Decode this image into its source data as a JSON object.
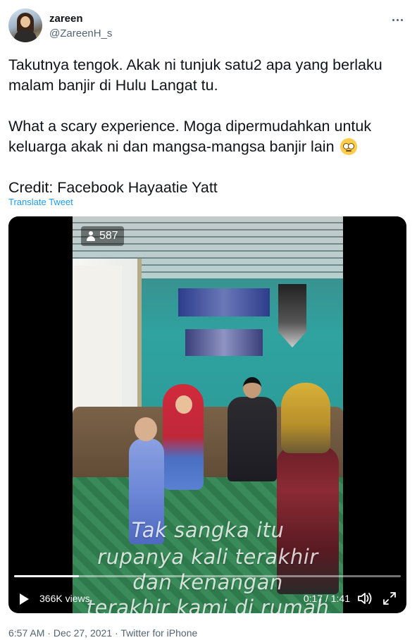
{
  "author": {
    "name": "zareen",
    "handle": "@ZareenH_s"
  },
  "tweet": {
    "line1": "Takutnya tengok. Akak ni tunjuk satu2 apa yang berlaku",
    "line2": "malam banjir di Hulu Langat tu.",
    "line3": "What a scary experience. Moga dipermudahkan untuk",
    "line4": "keluarga akak ni dan mangsa-mangsa banjir lain",
    "line5": "Credit: Facebook Hayaatie Yatt",
    "emoji": "face-with-rolling-eyes-emoji",
    "translate_label": "Translate Tweet"
  },
  "media": {
    "live_viewers": "587",
    "subtitles": [
      "Tak sangka itu",
      "rupanya kali terakhir",
      "dan kenangan",
      "terakhir kami di rumah"
    ],
    "views_label": "366K views",
    "time_label": "0:17 / 1:41",
    "progress_fraction": 0.168
  },
  "meta": {
    "time": "6:57 AM",
    "sep1": " · ",
    "date": "Dec 27, 2021",
    "sep2": " · ",
    "source": "Twitter for iPhone"
  },
  "colors": {
    "link": "#1d9bf0",
    "secondary_text": "#536471"
  }
}
